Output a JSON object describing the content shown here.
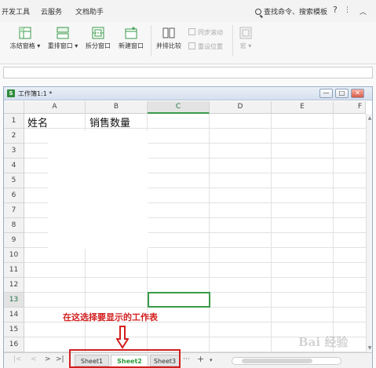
{
  "menubar": {
    "items": [
      "开发工具",
      "云服务",
      "文档助手"
    ],
    "search_label": "查找命令、搜索模板",
    "help_icon": "?",
    "collapse_icon": "︿"
  },
  "ribbon": {
    "freeze_label": "冻结窗格",
    "rearrange_label": "重排窗口",
    "split_label": "拆分窗口",
    "new_window_label": "新建窗口",
    "side_by_side_label": "并排比较",
    "sync_scroll_label": "同步滚动",
    "reset_position_label": "重设位置",
    "macro_label": "宏"
  },
  "workbook": {
    "title": "工作簿1:1 *",
    "minimize": "—",
    "restore": "□",
    "close": "✕"
  },
  "grid": {
    "columns": [
      "A",
      "B",
      "C",
      "D",
      "E",
      "F"
    ],
    "rows": [
      "1",
      "2",
      "3",
      "4",
      "5",
      "6",
      "7",
      "8",
      "9",
      "10",
      "11",
      "12",
      "13",
      "14",
      "15",
      "16"
    ],
    "a1": "姓名",
    "b1": "销售数量",
    "selected_column": "C",
    "selected_row": "13"
  },
  "tabs": {
    "nav": [
      "|<",
      "<",
      ">",
      ">|"
    ],
    "sheets": [
      "Sheet1",
      "Sheet2",
      "Sheet3"
    ],
    "active_sheet": "Sheet2",
    "more": "···",
    "add": "+"
  },
  "annotation": {
    "text": "在这选择要显示的工作表"
  },
  "watermark": "Bai 经验"
}
